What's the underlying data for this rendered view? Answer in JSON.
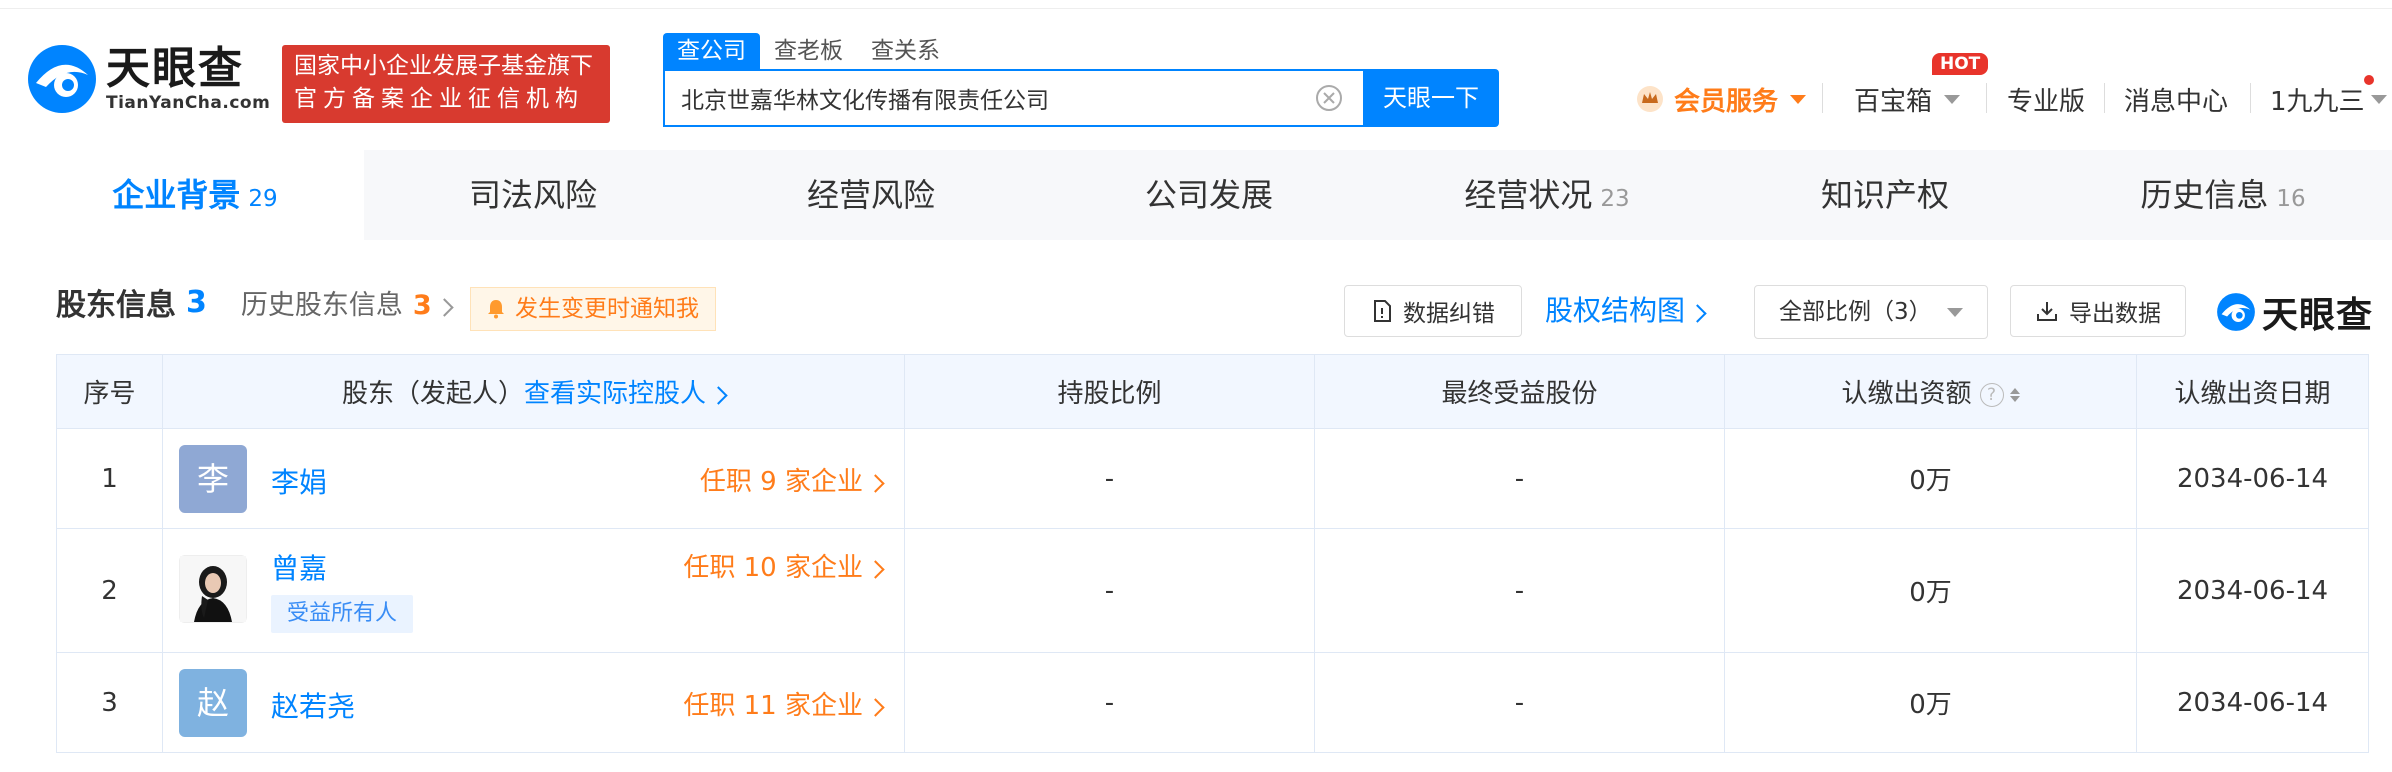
{
  "header": {
    "logo_cn": "天眼查",
    "logo_en": "TianYanCha.com",
    "badge_line1": "国家中小企业发展子基金旗下",
    "badge_line2": "官方备案企业征信机构",
    "search_tabs": [
      "查公司",
      "查老板",
      "查关系"
    ],
    "search_value": "北京世嘉华林文化传播有限责任公司",
    "search_button": "天眼一下",
    "member_label": "会员服务",
    "toolbox_label": "百宝箱",
    "hot_badge": "HOT",
    "pro_label": "专业版",
    "message_label": "消息中心",
    "user_label": "1九九三"
  },
  "tabs": [
    {
      "label": "企业背景",
      "count": "29"
    },
    {
      "label": "司法风险",
      "count": ""
    },
    {
      "label": "经营风险",
      "count": ""
    },
    {
      "label": "公司发展",
      "count": ""
    },
    {
      "label": "经营状况",
      "count": "23"
    },
    {
      "label": "知识产权",
      "count": ""
    },
    {
      "label": "历史信息",
      "count": "16"
    }
  ],
  "section": {
    "title": "股东信息",
    "count": "3",
    "history_label": "历史股东信息",
    "history_count": "3",
    "notify_label": "发生变更时通知我",
    "correct_label": "数据纠错",
    "equity_chart_label": "股权结构图",
    "ratio_select": "全部比例（3）",
    "export_label": "导出数据",
    "watermark": "天眼查"
  },
  "table": {
    "headers": {
      "index": "序号",
      "holder": "股东（发起人）",
      "holder_link": "查看实际控股人",
      "ratio": "持股比例",
      "final_share": "最终受益股份",
      "capital": "认缴出资额",
      "date": "认缴出资日期"
    },
    "rows": [
      {
        "index": "1",
        "avatar_char": "李",
        "avatar_color": "#8fa8d4",
        "name": "李娟",
        "jobs": "任职 9 家企业",
        "tag": "",
        "ratio": "-",
        "final_share": "-",
        "capital": "0万",
        "date": "2034-06-14"
      },
      {
        "index": "2",
        "avatar_char": "",
        "avatar_color": "#ffffff",
        "name": "曾嘉",
        "jobs": "任职 10 家企业",
        "tag": "受益所有人",
        "ratio": "-",
        "final_share": "-",
        "capital": "0万",
        "date": "2034-06-14"
      },
      {
        "index": "3",
        "avatar_char": "赵",
        "avatar_color": "#7fb2e0",
        "name": "赵若尧",
        "jobs": "任职 11 家企业",
        "tag": "",
        "ratio": "-",
        "final_share": "-",
        "capital": "0万",
        "date": "2034-06-14"
      }
    ]
  },
  "colors": {
    "brand_blue": "#0084ff",
    "orange": "#ff7c1a",
    "badge_red": "#d83a2f"
  }
}
